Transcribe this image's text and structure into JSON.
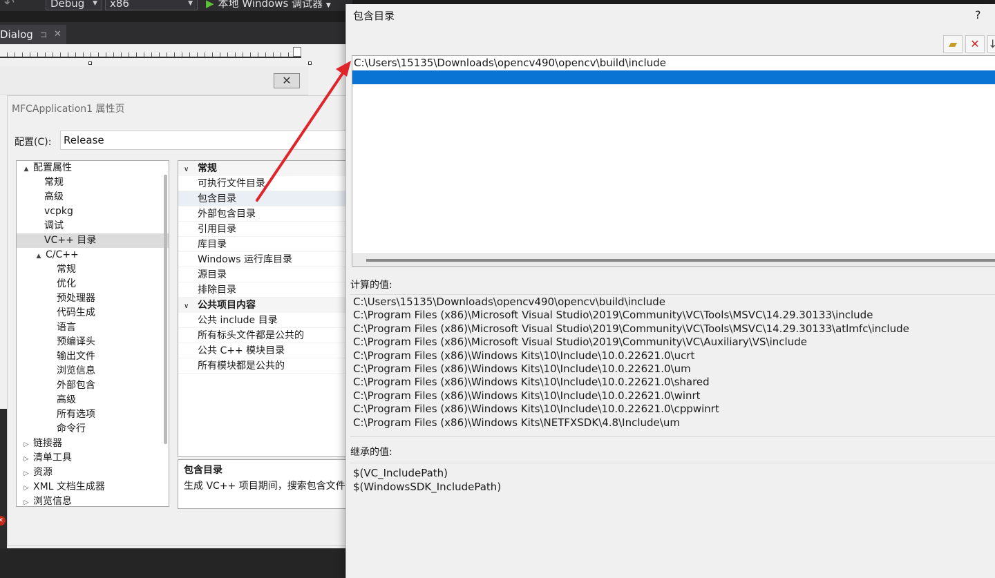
{
  "toolbar": {
    "config_combo": "Debug",
    "platform_combo": "x86",
    "run_label": "本地 Windows 调试器"
  },
  "doc_tab": {
    "label": "Dialog"
  },
  "property_pages": {
    "title": "MFCApplication1 属性页",
    "config_label": "配置(C):",
    "config_value": "Release",
    "tree": [
      {
        "label": "配置属性",
        "level": 0,
        "arrow": "▲"
      },
      {
        "label": "常规",
        "level": 1,
        "arrow": ""
      },
      {
        "label": "高级",
        "level": 1,
        "arrow": ""
      },
      {
        "label": "vcpkg",
        "level": 1,
        "arrow": ""
      },
      {
        "label": "调试",
        "level": 1,
        "arrow": ""
      },
      {
        "label": "VC++ 目录",
        "level": 1,
        "arrow": "",
        "selected": true
      },
      {
        "label": "C/C++",
        "level": 1,
        "arrow": "▲"
      },
      {
        "label": "常规",
        "level": 2,
        "arrow": ""
      },
      {
        "label": "优化",
        "level": 2,
        "arrow": ""
      },
      {
        "label": "预处理器",
        "level": 2,
        "arrow": ""
      },
      {
        "label": "代码生成",
        "level": 2,
        "arrow": ""
      },
      {
        "label": "语言",
        "level": 2,
        "arrow": ""
      },
      {
        "label": "预编译头",
        "level": 2,
        "arrow": ""
      },
      {
        "label": "输出文件",
        "level": 2,
        "arrow": ""
      },
      {
        "label": "浏览信息",
        "level": 2,
        "arrow": ""
      },
      {
        "label": "外部包含",
        "level": 2,
        "arrow": ""
      },
      {
        "label": "高级",
        "level": 2,
        "arrow": ""
      },
      {
        "label": "所有选项",
        "level": 2,
        "arrow": ""
      },
      {
        "label": "命令行",
        "level": 2,
        "arrow": ""
      },
      {
        "label": "链接器",
        "level": 0,
        "arrow": "▷"
      },
      {
        "label": "清单工具",
        "level": 0,
        "arrow": "▷"
      },
      {
        "label": "资源",
        "level": 0,
        "arrow": "▷"
      },
      {
        "label": "XML 文档生成器",
        "level": 0,
        "arrow": "▷"
      },
      {
        "label": "浏览信息",
        "level": 0,
        "arrow": "▷"
      }
    ],
    "grid": [
      {
        "type": "cat",
        "label": "常规"
      },
      {
        "type": "row",
        "label": "可执行文件目录"
      },
      {
        "type": "row",
        "label": "包含目录",
        "selected": true
      },
      {
        "type": "row",
        "label": "外部包含目录"
      },
      {
        "type": "row",
        "label": "引用目录"
      },
      {
        "type": "row",
        "label": "库目录"
      },
      {
        "type": "row",
        "label": "Windows 运行库目录"
      },
      {
        "type": "row",
        "label": "源目录"
      },
      {
        "type": "row",
        "label": "排除目录"
      },
      {
        "type": "cat",
        "label": "公共项目内容"
      },
      {
        "type": "row",
        "label": "公共 include 目录"
      },
      {
        "type": "row",
        "label": "所有标头文件都是公共的"
      },
      {
        "type": "row",
        "label": "公共 C++ 模块目录"
      },
      {
        "type": "row",
        "label": "所有模块都是公共的"
      }
    ],
    "description": {
      "title": "包含目录",
      "text": "生成 VC++ 项目期间，搜索包含文件"
    }
  },
  "include_dialog": {
    "title": "包含目录",
    "help": "?",
    "entries": [
      "C:\\Users\\15135\\Downloads\\opencv490\\opencv\\build\\include"
    ],
    "evaluated_label": "计算的值:",
    "evaluated": [
      "C:\\Users\\15135\\Downloads\\opencv490\\opencv\\build\\include",
      "C:\\Program Files (x86)\\Microsoft Visual Studio\\2019\\Community\\VC\\Tools\\MSVC\\14.29.30133\\include",
      "C:\\Program Files (x86)\\Microsoft Visual Studio\\2019\\Community\\VC\\Tools\\MSVC\\14.29.30133\\atlmfc\\include",
      "C:\\Program Files (x86)\\Microsoft Visual Studio\\2019\\Community\\VC\\Auxiliary\\VS\\include",
      "C:\\Program Files (x86)\\Windows Kits\\10\\Include\\10.0.22621.0\\ucrt",
      "C:\\Program Files (x86)\\Windows Kits\\10\\Include\\10.0.22621.0\\um",
      "C:\\Program Files (x86)\\Windows Kits\\10\\Include\\10.0.22621.0\\shared",
      "C:\\Program Files (x86)\\Windows Kits\\10\\Include\\10.0.22621.0\\winrt",
      "C:\\Program Files (x86)\\Windows Kits\\10\\Include\\10.0.22621.0\\cppwinrt",
      "C:\\Program Files (x86)\\Windows Kits\\NETFXSDK\\4.8\\Include\\um"
    ],
    "inherited_label": "继承的值:",
    "inherited": [
      "$(VC_IncludePath)",
      "$(WindowsSDK_IncludePath)"
    ]
  },
  "colors": {
    "selection_blue": "#0a74d4",
    "annotation_red": "#e0242b",
    "vs_dark": "#2d2d30"
  },
  "icons": {
    "new_line": "new-folder-icon",
    "delete": "delete-x-icon",
    "move_down": "arrow-down-icon"
  }
}
